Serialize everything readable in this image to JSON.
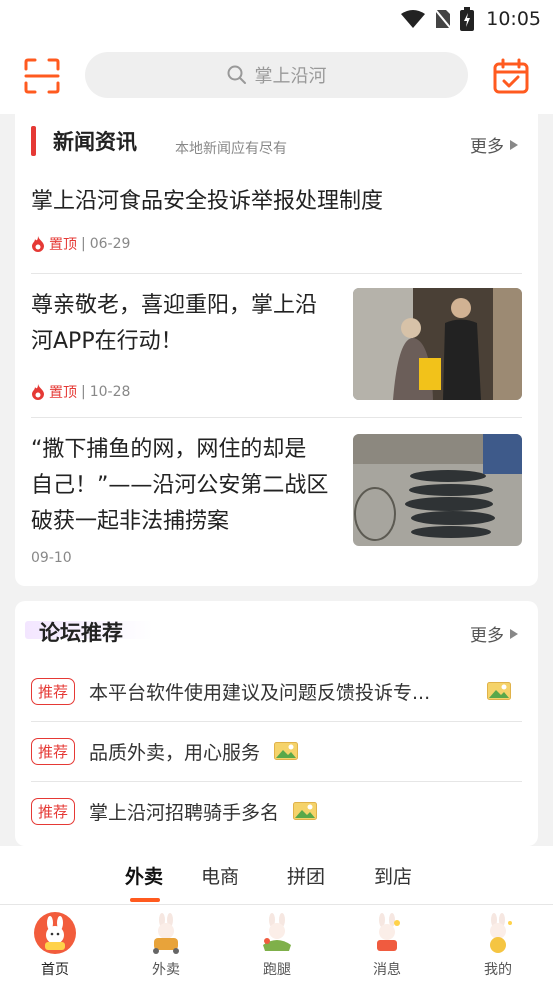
{
  "status_bar": {
    "time": "10:05"
  },
  "header": {
    "search_placeholder": "掌上沿河"
  },
  "news": {
    "title": "新闻资讯",
    "subtitle": "本地新闻应有尽有",
    "more": "更多",
    "items": [
      {
        "title": "掌上沿河食品安全投诉举报处理制度",
        "pin": "置顶",
        "date": "06-29"
      },
      {
        "title_line1": "尊亲敬老，喜迎重阳，掌上沿",
        "title_line2": "河APP在行动！",
        "pin": "置顶",
        "date": "10-28"
      },
      {
        "title_line1": "“撒下捕鱼的网，网住的却是",
        "title_line2": "自己！”——沿河公安第二战区",
        "title_line3": "破获一起非法捕捞案",
        "date": "09-10"
      }
    ]
  },
  "forum": {
    "title": "论坛推荐",
    "more": "更多",
    "tag": "推荐",
    "items": [
      {
        "text": "本平台软件使用建议及问题反馈投诉专..."
      },
      {
        "text": "品质外卖，用心服务"
      },
      {
        "text": "掌上沿河招聘骑手多名"
      }
    ]
  },
  "tabs": [
    "外卖",
    "电商",
    "拼团",
    "到店"
  ],
  "bottom_nav": [
    "首页",
    "外卖",
    "跑腿",
    "消息",
    "我的"
  ],
  "colors": {
    "accent": "#ff5a1f",
    "red": "#e53935"
  }
}
